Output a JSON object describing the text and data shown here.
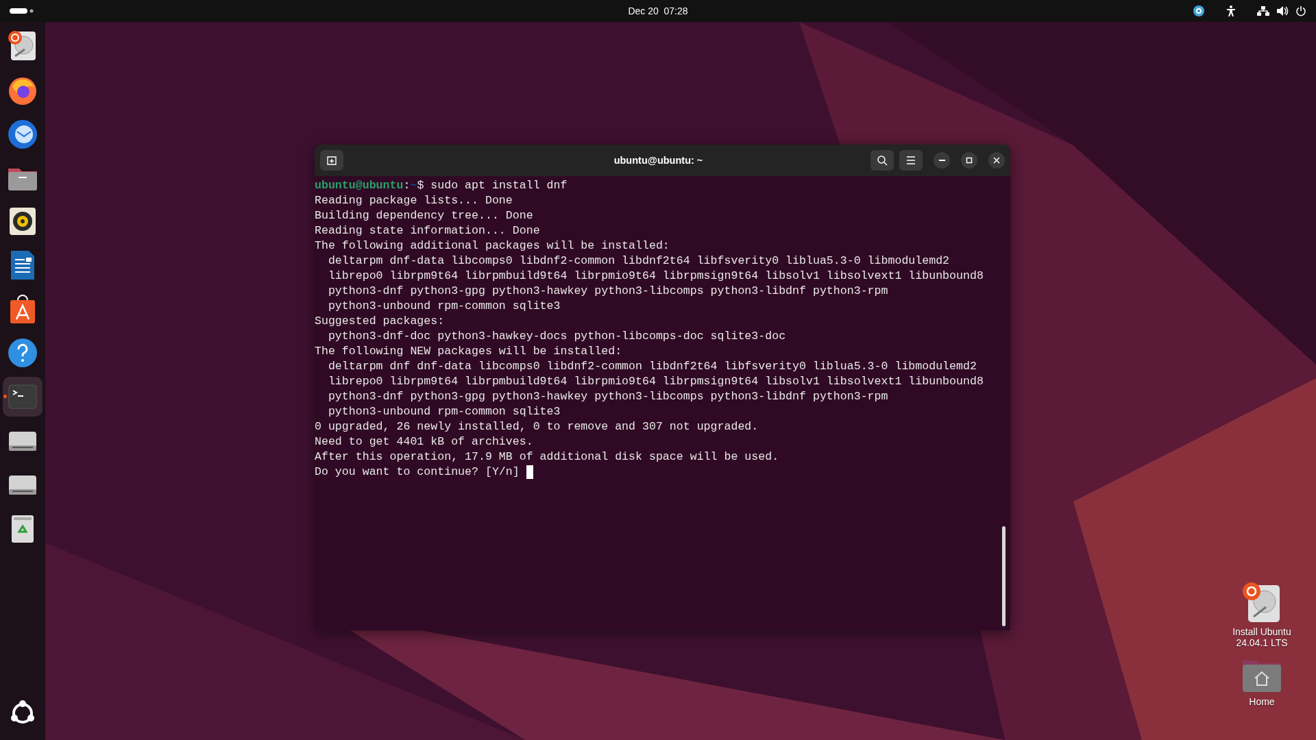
{
  "top_bar": {
    "clock": "Dec 20  07:28"
  },
  "dock": {
    "items": [
      {
        "kind": "installer",
        "active": false
      },
      {
        "kind": "browser",
        "active": false
      },
      {
        "kind": "mail",
        "active": false
      },
      {
        "kind": "files",
        "active": false
      },
      {
        "kind": "music",
        "active": false
      },
      {
        "kind": "writer",
        "active": false
      },
      {
        "kind": "store",
        "active": false
      },
      {
        "kind": "help",
        "active": false
      },
      {
        "kind": "terminal",
        "active": true
      },
      {
        "kind": "drive",
        "active": false
      },
      {
        "kind": "drive",
        "active": false
      },
      {
        "kind": "trash",
        "active": false
      }
    ]
  },
  "terminal": {
    "title": "ubuntu@ubuntu: ~",
    "lines": [
      {
        "kind": "prompt",
        "user": "ubuntu@ubuntu",
        "sep": ":",
        "path": "~",
        "command": "$ sudo apt install dnf"
      },
      {
        "kind": "text",
        "text": "Reading package lists... Done"
      },
      {
        "kind": "text",
        "text": "Building dependency tree... Done"
      },
      {
        "kind": "text",
        "text": "Reading state information... Done"
      },
      {
        "kind": "text",
        "text": "The following additional packages will be installed:"
      },
      {
        "kind": "text",
        "text": "  deltarpm dnf-data libcomps0 libdnf2-common libdnf2t64 libfsverity0 liblua5.3-0 libmodulemd2"
      },
      {
        "kind": "text",
        "text": "  librepo0 librpm9t64 librpmbuild9t64 librpmio9t64 librpmsign9t64 libsolv1 libsolvext1 libunbound8"
      },
      {
        "kind": "text",
        "text": "  python3-dnf python3-gpg python3-hawkey python3-libcomps python3-libdnf python3-rpm"
      },
      {
        "kind": "text",
        "text": "  python3-unbound rpm-common sqlite3"
      },
      {
        "kind": "text",
        "text": "Suggested packages:"
      },
      {
        "kind": "text",
        "text": "  python3-dnf-doc python3-hawkey-docs python-libcomps-doc sqlite3-doc"
      },
      {
        "kind": "text",
        "text": "The following NEW packages will be installed:"
      },
      {
        "kind": "text",
        "text": "  deltarpm dnf dnf-data libcomps0 libdnf2-common libdnf2t64 libfsverity0 liblua5.3-0 libmodulemd2"
      },
      {
        "kind": "text",
        "text": "  librepo0 librpm9t64 librpmbuild9t64 librpmio9t64 librpmsign9t64 libsolv1 libsolvext1 libunbound8"
      },
      {
        "kind": "text",
        "text": "  python3-dnf python3-gpg python3-hawkey python3-libcomps python3-libdnf python3-rpm"
      },
      {
        "kind": "text",
        "text": "  python3-unbound rpm-common sqlite3"
      },
      {
        "kind": "text",
        "text": "0 upgraded, 26 newly installed, 0 to remove and 307 not upgraded."
      },
      {
        "kind": "text",
        "text": "Need to get 4401 kB of archives."
      },
      {
        "kind": "text",
        "text": "After this operation, 17.9 MB of additional disk space will be used."
      },
      {
        "kind": "input",
        "text": "Do you want to continue? [Y/n] "
      }
    ]
  },
  "desktop_icons": [
    {
      "kind": "installer",
      "label": "Install Ubuntu 24.04.1 LTS"
    },
    {
      "kind": "home",
      "label": "Home"
    }
  ]
}
